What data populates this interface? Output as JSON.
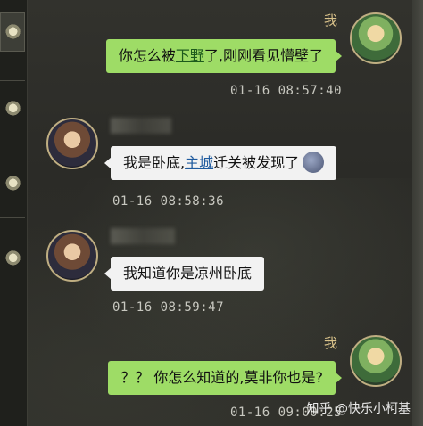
{
  "conversation": [
    {
      "sender": "self",
      "name": "我",
      "parts": [
        {
          "text": "你怎么被"
        },
        {
          "text": "下野",
          "link": true
        },
        {
          "text": "了,刚刚看见懵壁了"
        }
      ],
      "time": "01-16 08:57:40"
    },
    {
      "sender": "other",
      "parts": [
        {
          "text": "我是卧底,"
        },
        {
          "text": "主城",
          "link": true
        },
        {
          "text": "迁关被发现了"
        }
      ],
      "emoji": "sad-face-emoji",
      "time": "01-16 08:58:36"
    },
    {
      "sender": "other",
      "parts": [
        {
          "text": "我知道你是凉州卧底"
        }
      ],
      "time": "01-16 08:59:47"
    },
    {
      "sender": "self",
      "name": "我",
      "parts": [
        {
          "text": "？？ 你怎么知道的,莫非你也是?"
        }
      ],
      "time": "01-16 09:00:25"
    }
  ],
  "watermark": "知乎 @快乐小柯基",
  "colors": {
    "self_bubble": "#9edc66",
    "other_bubble": "#f2f2f2",
    "name": "#d9c28a",
    "timestamp": "#c8c8c0"
  },
  "icons": {
    "side_tabs": [
      "seal-icon",
      "seal-icon",
      "seal-icon",
      "seal-icon",
      "seal-icon"
    ]
  }
}
